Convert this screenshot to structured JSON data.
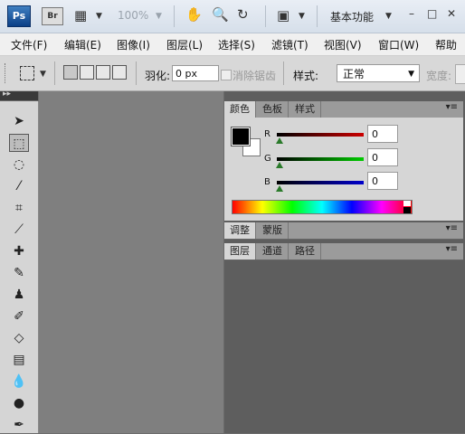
{
  "titlebar": {
    "app_logo": "Ps",
    "bridge_logo": "Br",
    "zoom": "100%",
    "workspace": "基本功能",
    "icons": [
      "film-icon",
      "hand-icon",
      "zoom-icon",
      "rotate-icon",
      "arrange-icon"
    ],
    "window_buttons": [
      "minimize",
      "restore",
      "close"
    ]
  },
  "menubar": {
    "items": [
      "文件(F)",
      "编辑(E)",
      "图像(I)",
      "图层(L)",
      "选择(S)",
      "滤镜(T)",
      "视图(V)",
      "窗口(W)",
      "帮助"
    ]
  },
  "options": {
    "feather_label": "羽化:",
    "feather_value": "0 px",
    "antialias_label": "消除锯齿",
    "style_label": "样式:",
    "style_value": "正常",
    "width_label": "宽度:"
  },
  "panels": {
    "color_tabs": [
      "颜色",
      "色板",
      "样式"
    ],
    "channels": [
      {
        "label": "R",
        "value": "0",
        "color": "#cc0000"
      },
      {
        "label": "G",
        "value": "0",
        "color": "#00aa00"
      },
      {
        "label": "B",
        "value": "0",
        "color": "#0000cc"
      }
    ],
    "adjust_tabs": [
      "调整",
      "蒙版"
    ],
    "layers_tabs": [
      "图层",
      "通道",
      "路径"
    ]
  },
  "toolbox": {
    "tools": [
      "move-tool",
      "marquee-tool",
      "lasso-tool",
      "magic-wand-tool",
      "crop-tool",
      "eyedropper-tool",
      "healing-tool",
      "brush-tool",
      "stamp-tool",
      "history-brush-tool",
      "eraser-tool",
      "gradient-tool",
      "blur-tool",
      "dodge-tool",
      "pen-tool"
    ]
  },
  "colors": {
    "foreground": "#000000",
    "background": "#ffffff"
  }
}
